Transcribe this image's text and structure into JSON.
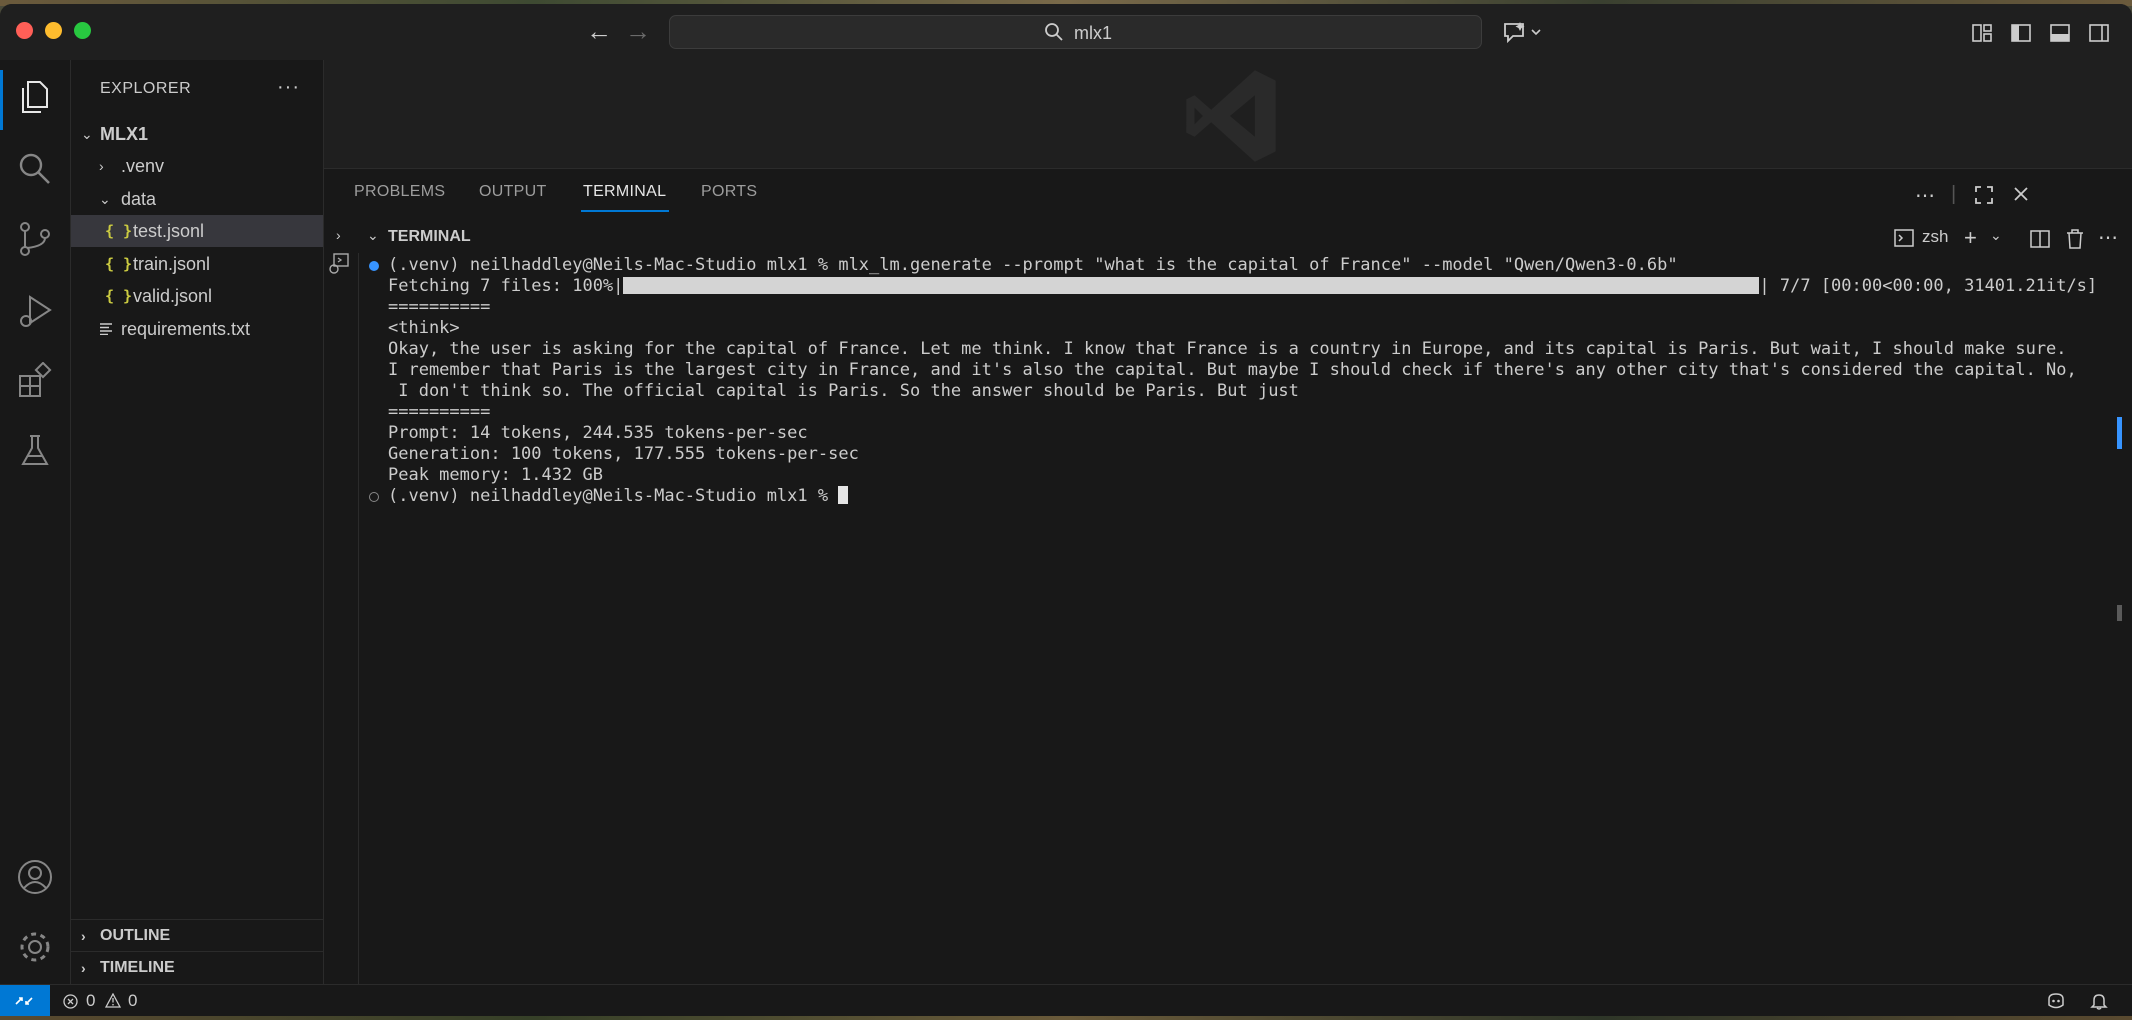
{
  "titlebar": {
    "search_text": "mlx1",
    "back_glyph": "←",
    "forward_glyph": "→"
  },
  "explorer": {
    "title": "EXPLORER",
    "more_glyph": "···",
    "root": "MLX1",
    "items": [
      {
        "label": ".venv",
        "kind": "folder",
        "expanded": false
      },
      {
        "label": "data",
        "kind": "folder",
        "expanded": true
      },
      {
        "label": "test.jsonl",
        "kind": "json",
        "selected": true
      },
      {
        "label": "train.jsonl",
        "kind": "json"
      },
      {
        "label": "valid.jsonl",
        "kind": "json"
      },
      {
        "label": "requirements.txt",
        "kind": "text"
      }
    ],
    "json_icon": "{ }",
    "outline": "OUTLINE",
    "timeline": "TIMELINE"
  },
  "panel": {
    "tabs": [
      "PROBLEMS",
      "OUTPUT",
      "TERMINAL",
      "PORTS"
    ],
    "active_tab": "TERMINAL",
    "section_title": "TERMINAL",
    "shell": "zsh"
  },
  "terminal": {
    "lines": [
      "(.venv) neilhaddley@Neils-Mac-Studio mlx1 % mlx_lm.generate --prompt \"what is the capital of France\" --model \"Qwen/Qwen3-0.6b\"",
      "Fetching 7 files: 100%|",
      "| 7/7 [00:00<00:00, 31401.21it/s]",
      "==========",
      "<think>",
      "Okay, the user is asking for the capital of France. Let me think. I know that France is a country in Europe, and its capital is Paris. But wait, I should make sure.",
      "I remember that Paris is the largest city in France, and it's also the capital. But maybe I should check if there's any other city that's considered the capital. No,",
      " I don't think so. The official capital is Paris. So the answer should be Paris. But just",
      "==========",
      "Prompt: 14 tokens, 244.535 tokens-per-sec",
      "Generation: 100 tokens, 177.555 tokens-per-sec",
      "Peak memory: 1.432 GB",
      "(.venv) neilhaddley@Neils-Mac-Studio mlx1 % "
    ],
    "progress_percent": 100
  },
  "statusbar": {
    "errors": "0",
    "warnings": "0"
  },
  "colors": {
    "accent": "#0078d4",
    "json_icon": "#cbcb41",
    "terminal_bg": "#181818"
  }
}
